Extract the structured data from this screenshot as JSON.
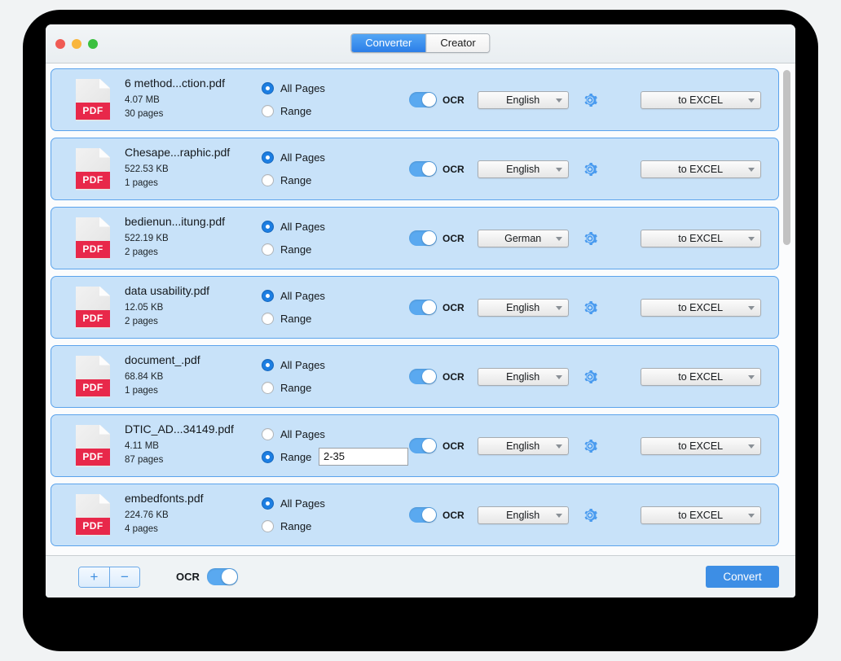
{
  "window": {
    "traffic_lights": [
      "close",
      "minimize",
      "maximize"
    ],
    "tabs": [
      {
        "label": "Converter",
        "active": true
      },
      {
        "label": "Creator",
        "active": false
      }
    ]
  },
  "colors": {
    "accent": "#3d8ee5",
    "row_background": "#c8e2f9",
    "row_border": "#5ba3ec",
    "pdf_badge": "#e8284a",
    "toggle_on": "#5aa9f0",
    "gear": "#4a9bef"
  },
  "list": {
    "rows": [
      {
        "icon": "pdf-file-icon",
        "badge": "PDF",
        "filename": "6 method...ction.pdf",
        "filesize": "4.07 MB",
        "pagecount": "30 pages",
        "all_pages_label": "All Pages",
        "range_label": "Range",
        "selection": "all",
        "range_value": "",
        "ocr_label": "OCR",
        "ocr_on": true,
        "language": "English",
        "format": "to EXCEL"
      },
      {
        "icon": "pdf-file-icon",
        "badge": "PDF",
        "filename": "Chesape...raphic.pdf",
        "filesize": "522.53 KB",
        "pagecount": "1 pages",
        "all_pages_label": "All Pages",
        "range_label": "Range",
        "selection": "all",
        "range_value": "",
        "ocr_label": "OCR",
        "ocr_on": true,
        "language": "English",
        "format": "to EXCEL"
      },
      {
        "icon": "pdf-file-icon",
        "badge": "PDF",
        "filename": "bedienun...itung.pdf",
        "filesize": "522.19 KB",
        "pagecount": "2 pages",
        "all_pages_label": "All Pages",
        "range_label": "Range",
        "selection": "all",
        "range_value": "",
        "ocr_label": "OCR",
        "ocr_on": true,
        "language": "German",
        "format": "to EXCEL"
      },
      {
        "icon": "pdf-file-icon",
        "badge": "PDF",
        "filename": "data usability.pdf",
        "filesize": "12.05 KB",
        "pagecount": "2 pages",
        "all_pages_label": "All Pages",
        "range_label": "Range",
        "selection": "all",
        "range_value": "",
        "ocr_label": "OCR",
        "ocr_on": true,
        "language": "English",
        "format": "to EXCEL"
      },
      {
        "icon": "pdf-file-icon",
        "badge": "PDF",
        "filename": "document_.pdf",
        "filesize": "68.84 KB",
        "pagecount": "1 pages",
        "all_pages_label": "All Pages",
        "range_label": "Range",
        "selection": "all",
        "range_value": "",
        "ocr_label": "OCR",
        "ocr_on": true,
        "language": "English",
        "format": "to EXCEL"
      },
      {
        "icon": "pdf-file-icon",
        "badge": "PDF",
        "filename": "DTIC_AD...34149.pdf",
        "filesize": "4.11 MB",
        "pagecount": "87 pages",
        "all_pages_label": "All Pages",
        "range_label": "Range",
        "selection": "range",
        "range_value": "2-35",
        "ocr_label": "OCR",
        "ocr_on": true,
        "language": "English",
        "format": "to EXCEL"
      },
      {
        "icon": "pdf-file-icon",
        "badge": "PDF",
        "filename": "embedfonts.pdf",
        "filesize": "224.76 KB",
        "pagecount": "4 pages",
        "all_pages_label": "All Pages",
        "range_label": "Range",
        "selection": "all",
        "range_value": "",
        "ocr_label": "OCR",
        "ocr_on": true,
        "language": "English",
        "format": "to EXCEL"
      }
    ]
  },
  "bottom_bar": {
    "add_label": "+",
    "remove_label": "−",
    "ocr_label": "OCR",
    "ocr_on": true,
    "convert_label": "Convert"
  }
}
